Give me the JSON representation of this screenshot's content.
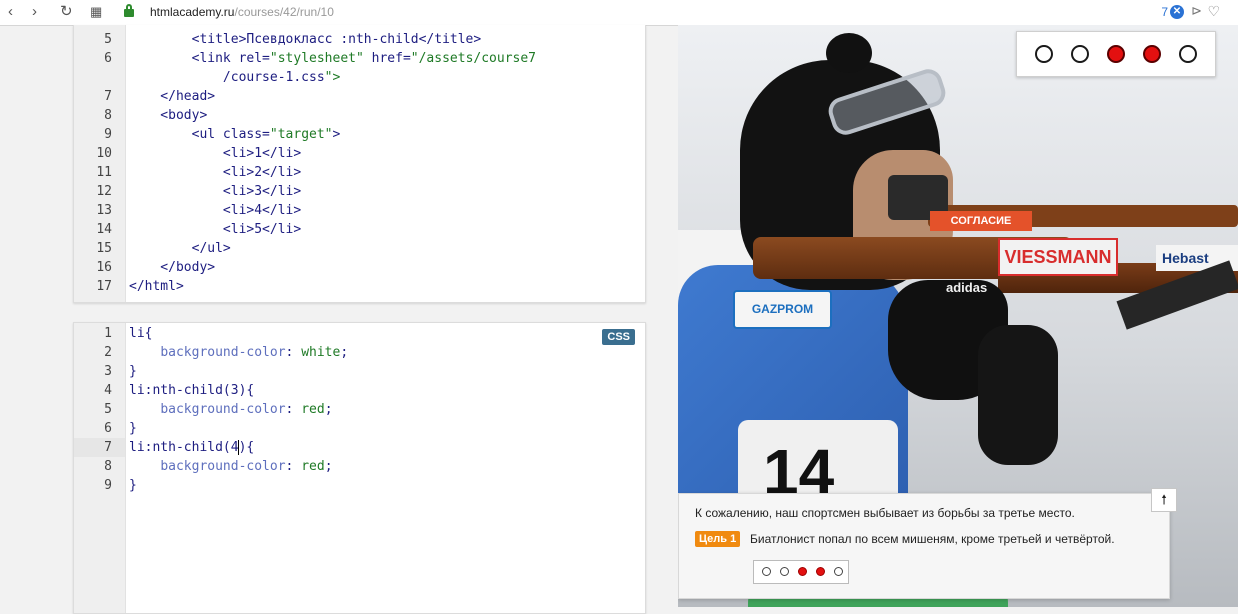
{
  "browser": {
    "nav": {
      "back": "‹",
      "forward": "›",
      "reload": "↻",
      "apps": "▦"
    },
    "url_host": "htmlacademy.ru",
    "url_path": "/courses/42/run/10",
    "ext_count": "7",
    "ext_x": "✕",
    "ext_send": "⊳",
    "ext_heart": "♡"
  },
  "html_editor": {
    "lines": [
      {
        "n": "5",
        "t": "        <title>Псевдокласс :nth-child</title>"
      },
      {
        "n": "6",
        "t": "        <link rel=\"stylesheet\" href=\"/assets/course7"
      },
      {
        "n": "",
        "t": "            /course-1.css\">"
      },
      {
        "n": "7",
        "t": "    </head>"
      },
      {
        "n": "8",
        "t": "    <body>"
      },
      {
        "n": "9",
        "t": "        <ul class=\"target\">"
      },
      {
        "n": "10",
        "t": "            <li>1</li>"
      },
      {
        "n": "11",
        "t": "            <li>2</li>"
      },
      {
        "n": "12",
        "t": "            <li>3</li>"
      },
      {
        "n": "13",
        "t": "            <li>4</li>"
      },
      {
        "n": "14",
        "t": "            <li>5</li>"
      },
      {
        "n": "15",
        "t": "        </ul>"
      },
      {
        "n": "16",
        "t": "    </body>"
      },
      {
        "n": "17",
        "t": "</html>"
      }
    ]
  },
  "css_editor": {
    "badge": "CSS",
    "lines": [
      {
        "n": "1",
        "t": "li{"
      },
      {
        "n": "2",
        "t": "    background-color: white;"
      },
      {
        "n": "3",
        "t": "}"
      },
      {
        "n": "4",
        "t": "li:nth-child(3){"
      },
      {
        "n": "5",
        "t": "    background-color: red;"
      },
      {
        "n": "6",
        "t": "}"
      },
      {
        "n": "7",
        "t": "li:nth-child(4){"
      },
      {
        "n": "8",
        "t": "    background-color: red;"
      },
      {
        "n": "9",
        "t": "}"
      }
    ],
    "active_line": "7"
  },
  "result": {
    "targets": [
      false,
      false,
      true,
      true,
      false
    ],
    "sponsors": {
      "soglasie": "СОГЛАСИЕ",
      "viessmann": "VIESSMANN",
      "hebast": "Hebast",
      "gazprom": "GAZPROM",
      "adidas": "adidas"
    },
    "bib": "14",
    "message": "К сожалению, наш спортсмен выбывает из борьбы за третье место.",
    "goal_label": "Цель 1",
    "goal_text": "Биатлонист попал по всем мишеням, кроме третьей и четвёртой.",
    "mini_targets": [
      false,
      false,
      true,
      true,
      false
    ],
    "up_button": "🠕"
  },
  "colors": {
    "hit": "#e31010",
    "goal": "#f08a10",
    "css_badge": "#3a6e8f"
  }
}
